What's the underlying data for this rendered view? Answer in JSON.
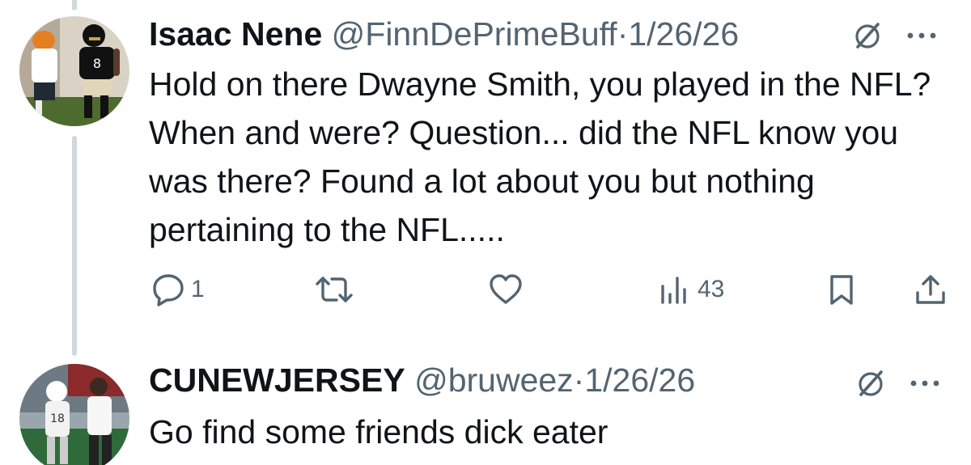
{
  "tweets": [
    {
      "display_name": "Isaac Nene",
      "handle": "@FinnDePrimeBuff",
      "separator": "·",
      "date": "1/26/26",
      "text": "Hold on there Dwayne Smith, you played in the NFL? When and were? Question... did the NFL know you was there? Found a lot about you but nothing pertaining to the NFL.....",
      "actions": {
        "reply_count": "1",
        "repost_count": "",
        "like_count": "",
        "views_count": "43"
      }
    },
    {
      "display_name": "CUNEWJERSEY",
      "handle": "@bruweez",
      "separator": "·",
      "date": "1/26/26",
      "text": "Go find some friends dick eater"
    }
  ],
  "icons": {
    "reply": "reply-bubble-icon",
    "repost": "repost-arrows-icon",
    "like": "heart-icon",
    "views": "bar-chart-icon",
    "bookmark": "bookmark-icon",
    "share": "share-upload-icon",
    "grok": "grok-slash-icon",
    "more": "ellipsis-icon"
  },
  "colors": {
    "text": "#0f1419",
    "secondary": "#536471",
    "thread_line": "#cfd9de",
    "background": "#ffffff"
  }
}
